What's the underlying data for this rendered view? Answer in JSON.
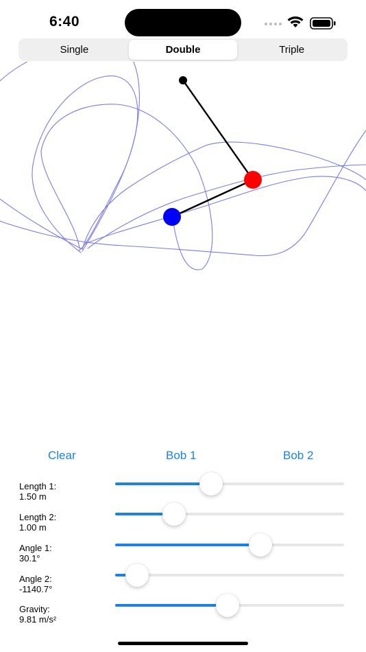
{
  "status_bar": {
    "time": "6:40"
  },
  "segments": [
    {
      "label": "Single",
      "selected": false
    },
    {
      "label": "Double",
      "selected": true
    },
    {
      "label": "Triple",
      "selected": false
    }
  ],
  "actions": {
    "clear": "Clear",
    "bob1": "Bob 1",
    "bob2": "Bob 2"
  },
  "colors": {
    "accent": "#1a82e6",
    "trail": "#7b7be8",
    "bob1": "#0000ff",
    "bob2": "#ff0000",
    "rod": "#000000"
  },
  "sliders": [
    {
      "name": "Length 1:",
      "value": "1.50 m",
      "fraction": 0.41
    },
    {
      "name": "Length 2:",
      "value": "1.00 m",
      "fraction": 0.23
    },
    {
      "name": "Angle 1:",
      "value": "30.1°",
      "fraction": 0.65
    },
    {
      "name": "Angle 2:",
      "value": "-1140.7°",
      "fraction": 0.05
    },
    {
      "name": "Gravity:",
      "value": "9.81 m/s²",
      "fraction": 0.49
    }
  ]
}
